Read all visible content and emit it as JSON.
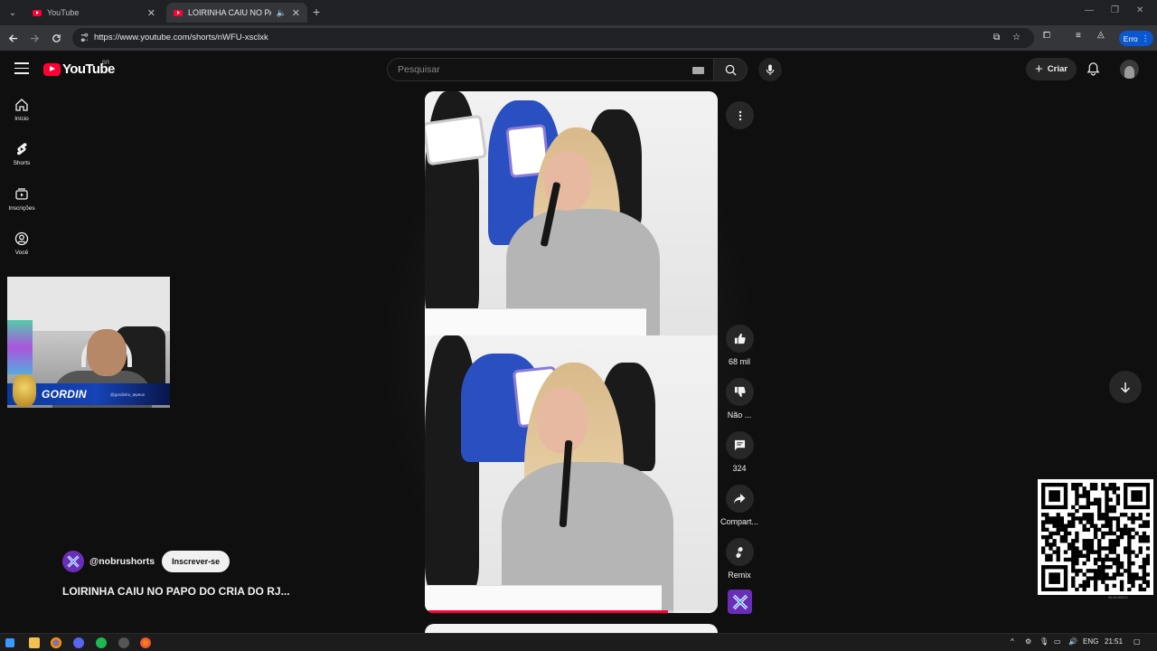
{
  "browser": {
    "tabs": [
      {
        "title": "YouTube"
      },
      {
        "title": "LOIRINHA CAIU NO PAPO D"
      }
    ],
    "url": "https://www.youtube.com/shorts/nWFU-xsclxk",
    "profile_button": "Erro"
  },
  "header": {
    "logo_text": "YouTube",
    "country_code": "BR",
    "search_placeholder": "Pesquisar",
    "create_label": "Criar"
  },
  "sidebar": {
    "items": [
      {
        "label": "Início",
        "icon": "home-icon"
      },
      {
        "label": "Shorts",
        "icon": "shorts-icon"
      },
      {
        "label": "Inscrições",
        "icon": "subscriptions-icon"
      },
      {
        "label": "Você",
        "icon": "you-icon"
      }
    ]
  },
  "webcam": {
    "name": "GORDIN",
    "subtext": "@gordinho_tepeuv"
  },
  "short": {
    "channel_handle": "@nobrushorts",
    "subscribe_label": "Inscrever-se",
    "title": "LOIRINHA CAIU NO PAPO DO CRIA DO RJ...",
    "progress": 0.83,
    "actions": {
      "likes": "68 mil",
      "dislike": "Não ...",
      "comments": "324",
      "share": "Compart...",
      "remix": "Remix"
    }
  },
  "overlay": {
    "qr_caption": "BLACKBOX"
  },
  "taskbar": {
    "lang": "ENG",
    "time": "21:51"
  },
  "colors": {
    "brand_red": "#ff0033",
    "background": "#0f0f0f",
    "channel_purple": "#6a2db8"
  }
}
